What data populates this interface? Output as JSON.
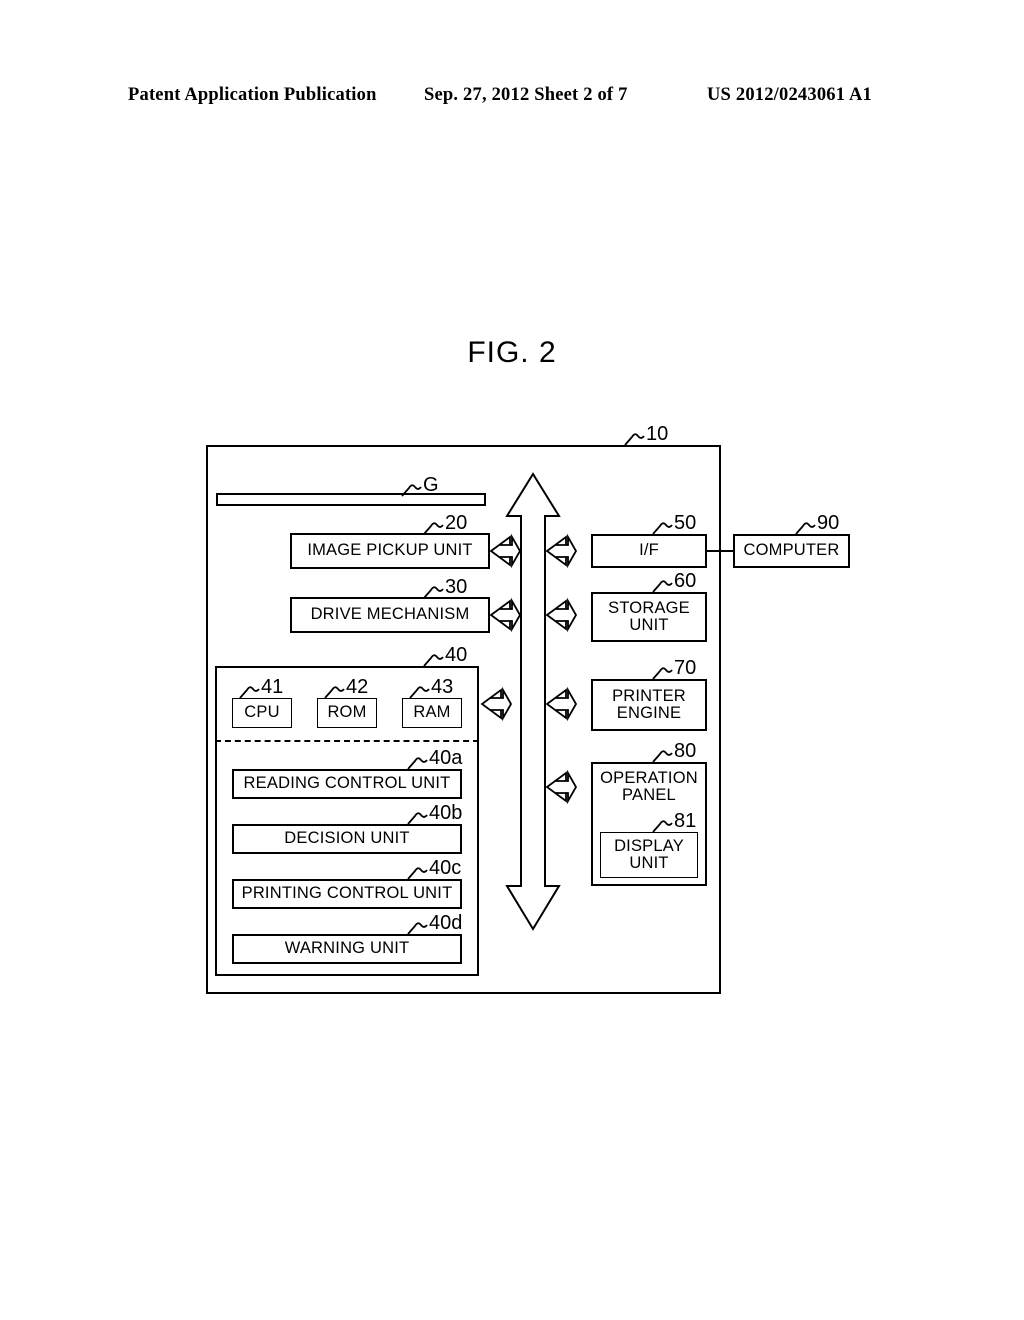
{
  "header": {
    "left": "Patent Application Publication",
    "middle": "Sep. 27, 2012   Sheet 2 of 7",
    "right": "US 2012/0243061 A1"
  },
  "figure": {
    "title": "FIG. 2",
    "device_ref": "10",
    "glass_ref": "G"
  },
  "blocks": {
    "image_pickup_unit": {
      "label": "IMAGE PICKUP UNIT",
      "ref": "20"
    },
    "drive_mechanism": {
      "label": "DRIVE MECHANISM",
      "ref": "30"
    },
    "control_unit": {
      "label": "",
      "ref": "40"
    },
    "cpu": {
      "label": "CPU",
      "ref": "41"
    },
    "rom": {
      "label": "ROM",
      "ref": "42"
    },
    "ram": {
      "label": "RAM",
      "ref": "43"
    },
    "reading_control_unit": {
      "label": "READING CONTROL UNIT",
      "ref": "40a"
    },
    "decision_unit": {
      "label": "DECISION UNIT",
      "ref": "40b"
    },
    "printing_control_unit": {
      "label": "PRINTING CONTROL UNIT",
      "ref": "40c"
    },
    "warning_unit": {
      "label": "WARNING UNIT",
      "ref": "40d"
    },
    "interface": {
      "label": "I/F",
      "ref": "50"
    },
    "storage_unit": {
      "label": "STORAGE\nUNIT",
      "ref": "60"
    },
    "printer_engine": {
      "label": "PRINTER\nENGINE",
      "ref": "70"
    },
    "operation_panel": {
      "label": "OPERATION\nPANEL",
      "ref": "80"
    },
    "display_unit": {
      "label": "DISPLAY\nUNIT",
      "ref": "81"
    },
    "computer": {
      "label": "COMPUTER",
      "ref": "90"
    }
  },
  "connections": [
    {
      "from": "image_pickup_unit",
      "to": "bus",
      "type": "bidirectional"
    },
    {
      "from": "drive_mechanism",
      "to": "bus",
      "type": "bidirectional"
    },
    {
      "from": "control_unit",
      "to": "bus",
      "type": "bidirectional"
    },
    {
      "from": "bus",
      "to": "interface",
      "type": "bidirectional"
    },
    {
      "from": "bus",
      "to": "storage_unit",
      "type": "bidirectional"
    },
    {
      "from": "bus",
      "to": "printer_engine",
      "type": "bidirectional"
    },
    {
      "from": "bus",
      "to": "operation_panel",
      "type": "bidirectional"
    },
    {
      "from": "interface",
      "to": "computer",
      "type": "line"
    }
  ],
  "bus": {
    "name": "system-bus",
    "type": "vertical-double-arrow"
  },
  "colors": {
    "ink": "#000000",
    "paper": "#ffffff"
  }
}
